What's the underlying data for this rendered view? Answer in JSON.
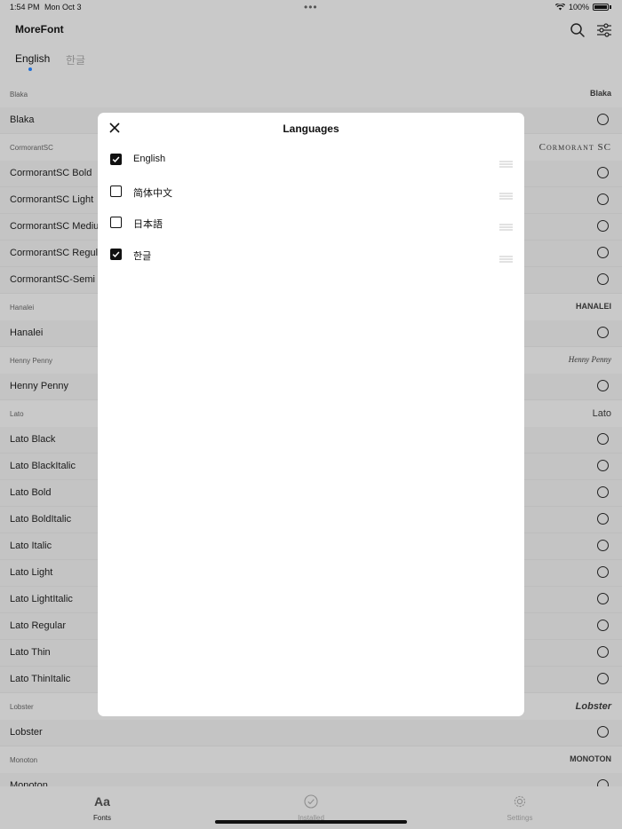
{
  "status_bar": {
    "time": "1:54 PM",
    "date": "Mon Oct 3",
    "battery": "100%"
  },
  "header": {
    "title": "MoreFont"
  },
  "language_tabs": [
    {
      "label": "English",
      "active": true
    },
    {
      "label": "한글",
      "active": false
    }
  ],
  "sections": [
    {
      "name": "Blaka",
      "preview": "Blaka",
      "fonts": [
        "Blaka"
      ]
    },
    {
      "name": "CormorantSC",
      "preview": "Cormorant SC",
      "fonts": [
        "CormorantSC Bold",
        "CormorantSC Light",
        "CormorantSC Mediu",
        "CormorantSC Regul",
        "CormorantSC-Semi"
      ]
    },
    {
      "name": "Hanalei",
      "preview": "HANALEI",
      "fonts": [
        "Hanalei"
      ]
    },
    {
      "name": "Henny Penny",
      "preview": "Henny Penny",
      "fonts": [
        "Henny Penny"
      ]
    },
    {
      "name": "Lato",
      "preview": "Lato",
      "fonts": [
        "Lato Black",
        "Lato BlackItalic",
        "Lato Bold",
        "Lato BoldItalic",
        "Lato Italic",
        "Lato Light",
        "Lato LightItalic",
        "Lato Regular",
        "Lato Thin",
        "Lato ThinItalic"
      ]
    },
    {
      "name": "Lobster",
      "preview": "Lobster",
      "fonts": [
        "Lobster"
      ]
    },
    {
      "name": "Monoton",
      "preview": "MONOTON",
      "fonts": [
        "Monoton"
      ]
    }
  ],
  "modal": {
    "title": "Languages",
    "languages": [
      {
        "label": "English",
        "checked": true
      },
      {
        "label": "简体中文",
        "checked": false
      },
      {
        "label": "日本語",
        "checked": false
      },
      {
        "label": "한글",
        "checked": true
      }
    ]
  },
  "tab_bar": [
    {
      "label": "Fonts",
      "icon": "Aa",
      "active": true
    },
    {
      "label": "Installed",
      "icon": "checkmark-circle-icon",
      "active": false
    },
    {
      "label": "Settings",
      "icon": "gear-icon",
      "active": false
    }
  ],
  "colors": {
    "accent": "#1e6fd9",
    "overlay": "#c9c9c9",
    "modal_bg": "#ffffff"
  }
}
